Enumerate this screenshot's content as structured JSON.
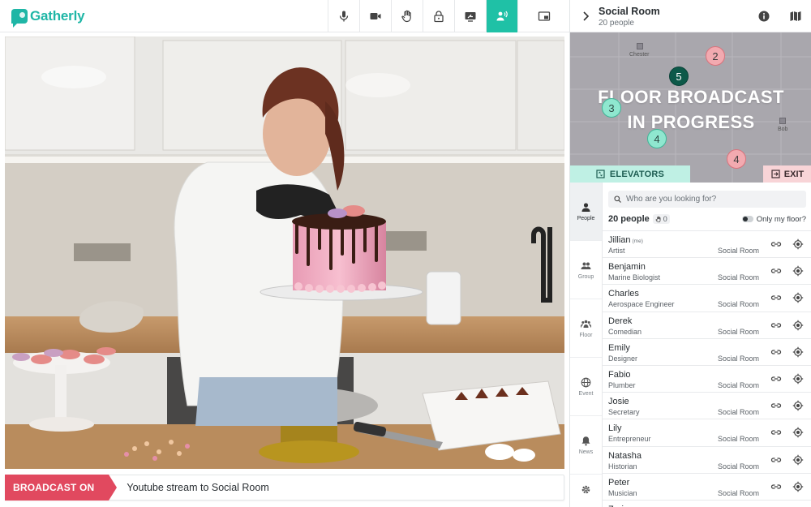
{
  "app": {
    "name": "Gatherly"
  },
  "toolbar": {
    "buttons": [
      {
        "name": "microphone",
        "icon": "microphone-icon"
      },
      {
        "name": "camera",
        "icon": "camera-icon"
      },
      {
        "name": "raise-hand",
        "icon": "hand-icon"
      },
      {
        "name": "lock",
        "icon": "lock-icon"
      },
      {
        "name": "screen-share",
        "icon": "screen-share-icon"
      },
      {
        "name": "broadcast",
        "icon": "broadcast-speaker-icon",
        "active": true
      },
      {
        "name": "picture-in-picture",
        "icon": "pip-icon"
      }
    ]
  },
  "broadcast_bar": {
    "badge": "BROADCAST ON",
    "text": "Youtube stream to Social Room"
  },
  "room": {
    "title": "Social Room",
    "subtitle": "20 people"
  },
  "map": {
    "broadcast_line1": "FLOOR BROADCAST",
    "broadcast_line2": "IN PROGRESS",
    "seats": [
      "Chester",
      "Bob"
    ],
    "markers": [
      "2",
      "5",
      "3",
      "4",
      "4"
    ],
    "elevators_label": "ELEVATORS",
    "exit_label": "EXIT"
  },
  "tabs": [
    {
      "label": "People",
      "icon": "person-icon",
      "active": true
    },
    {
      "label": "Group",
      "icon": "group-icon"
    },
    {
      "label": "Floor",
      "icon": "floor-icon"
    },
    {
      "label": "Event",
      "icon": "globe-icon"
    },
    {
      "label": "News",
      "icon": "bell-icon"
    },
    {
      "label": "",
      "icon": "gear-icon"
    }
  ],
  "people": {
    "search_placeholder": "Who are you looking for?",
    "count_label": "20 people",
    "hands_count": "0",
    "only_my_floor": "Only my floor?",
    "me_tag": "(me)",
    "list": [
      {
        "name": "Jillian",
        "role": "Artist",
        "room": "Social Room",
        "me": true
      },
      {
        "name": "Benjamin",
        "role": "Marine Biologist",
        "room": "Social Room"
      },
      {
        "name": "Charles",
        "role": "Aerospace Engineer",
        "room": "Social Room"
      },
      {
        "name": "Derek",
        "role": "Comedian",
        "room": "Social Room"
      },
      {
        "name": "Emily",
        "role": "Designer",
        "room": "Social Room"
      },
      {
        "name": "Fabio",
        "role": "Plumber",
        "room": "Social Room"
      },
      {
        "name": "Josie",
        "role": "Secretary",
        "room": "Social Room"
      },
      {
        "name": "Lily",
        "role": "Entrepreneur",
        "room": "Social Room"
      },
      {
        "name": "Natasha",
        "role": "Historian",
        "room": "Social Room"
      },
      {
        "name": "Peter",
        "role": "Musician",
        "room": "Social Room"
      },
      {
        "name": "Zoria",
        "role": "",
        "room": ""
      }
    ]
  },
  "colors": {
    "brand": "#1fb6a6",
    "active": "#1fc1a6",
    "broadcast": "#e1495f"
  }
}
